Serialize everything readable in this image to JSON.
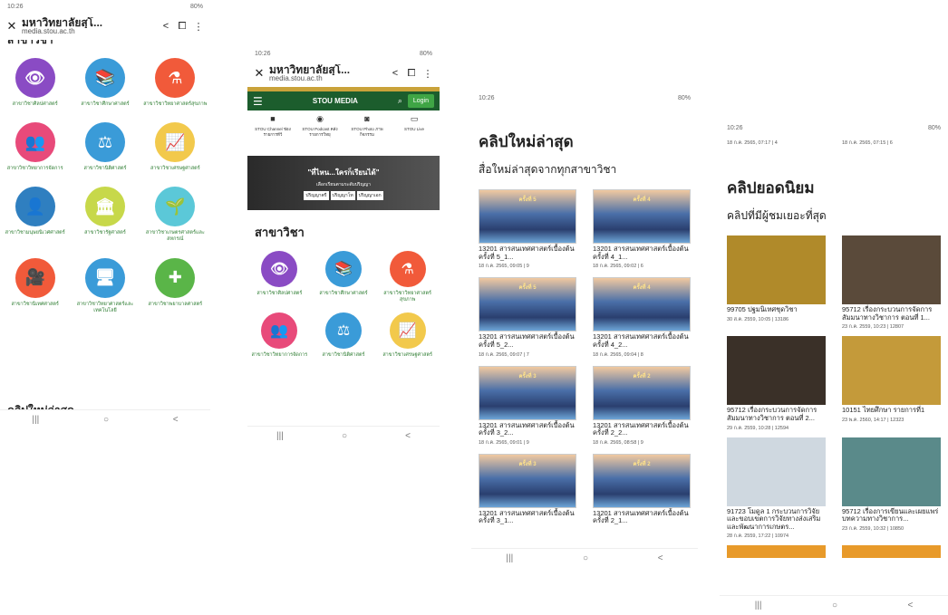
{
  "browser": {
    "title": "มหาวิทยาลัยสุโ...",
    "url": "media.stou.ac.th",
    "share": "<",
    "bookmark": "⧠",
    "more": "⋮",
    "close": "✕"
  },
  "status": {
    "time": "10:26",
    "battery": "80%"
  },
  "nav": {
    "recent": "|||",
    "home": "○",
    "back": "<"
  },
  "panel1": {
    "cut_top": "สาขาวิชา",
    "cut_bottom": "คลิปใหม่ล่าสุด",
    "items": [
      {
        "label": "สาขาวิชาศิลปศาสตร์",
        "color": "#8a4bc4",
        "glyph": "👁"
      },
      {
        "label": "สาขาวิชาศึกษาศาสตร์",
        "color": "#3a9bd8",
        "glyph": "📚"
      },
      {
        "label": "สาขาวิชาวิทยาศาสตร์สุขภาพ",
        "color": "#f15a3a",
        "glyph": "⚗"
      },
      {
        "label": "สาขาวิชาวิทยาการจัดการ",
        "color": "#e84a7a",
        "glyph": "👥"
      },
      {
        "label": "สาขาวิชานิติศาสตร์",
        "color": "#3a9bd8",
        "glyph": "⚖"
      },
      {
        "label": "สาขาวิชาเศรษฐศาสตร์",
        "color": "#f2c94c",
        "glyph": "📈"
      },
      {
        "label": "สาขาวิชามนุษยนิเวศศาสตร์",
        "color": "#2f7fc0",
        "glyph": "👤"
      },
      {
        "label": "สาขาวิชารัฐศาสตร์",
        "color": "#c7d84a",
        "glyph": "🏛"
      },
      {
        "label": "สาขาวิชาเกษตรศาสตร์และสหกรณ์",
        "color": "#5bc8d8",
        "glyph": "🌱"
      },
      {
        "label": "สาขาวิชานิเทศศาสตร์",
        "color": "#f15a3a",
        "glyph": "🎥"
      },
      {
        "label": "สาขาวิชาวิทยาศาสตร์และเทคโนโลยี",
        "color": "#3a9bd8",
        "glyph": "🖥"
      },
      {
        "label": "สาขาวิชาพยาบาลศาสตร์",
        "color": "#5ab548",
        "glyph": "✚"
      }
    ]
  },
  "panel2": {
    "brand": "STOU MEDIA",
    "login": "Login",
    "media": [
      {
        "glyph": "■",
        "text": "STOU Channel ช่องรายการทีวี"
      },
      {
        "glyph": "◉",
        "text": "STOU Podcast คลังรายการวิทยุ"
      },
      {
        "glyph": "◙",
        "text": "STOU Photo ภาพกิจกรรม"
      },
      {
        "glyph": "▭",
        "text": "STOU Live"
      }
    ],
    "banner": {
      "title": "\"ที่ไหน...ใครก็เรียนได้\"",
      "sub": "เลือกเรียนตามระดับปริญญา",
      "chips": [
        "ปริญญาตรี",
        "ปริญญาโท",
        "ปริญญาเอก"
      ]
    },
    "section": "สาขาวิชา",
    "items": [
      {
        "label": "สาขาวิชาศิลปศาสตร์",
        "color": "#8a4bc4",
        "glyph": "👁"
      },
      {
        "label": "สาขาวิชาศึกษาศาสตร์",
        "color": "#3a9bd8",
        "glyph": "📚"
      },
      {
        "label": "สาขาวิชาวิทยาศาสตร์สุขภาพ",
        "color": "#f15a3a",
        "glyph": "⚗"
      },
      {
        "label": "สาขาวิชาวิทยาการจัดการ",
        "color": "#e84a7a",
        "glyph": "👥"
      },
      {
        "label": "สาขาวิชานิติศาสตร์",
        "color": "#3a9bd8",
        "glyph": "⚖"
      },
      {
        "label": "สาขาวิชาเศรษฐศาสตร์",
        "color": "#f2c94c",
        "glyph": "📈"
      }
    ]
  },
  "panel3": {
    "title": "คลิปใหม่ล่าสุด",
    "subtitle": "สื่อใหม่ล่าสุดจากทุกสาขาวิชา",
    "videos": [
      {
        "thumb": "ครั้งที่ 5",
        "title": "13201 สารสนเทศศาสตร์เบื้องต้น ครั้งที่ 5_1...",
        "meta": "18 ก.ค. 2565, 09:05 | 9"
      },
      {
        "thumb": "ครั้งที่ 4",
        "title": "13201 สารสนเทศศาสตร์เบื้องต้น ครั้งที่ 4_1...",
        "meta": "18 ก.ค. 2565, 09:02 | 6"
      },
      {
        "thumb": "ครั้งที่ 5",
        "title": "13201 สารสนเทศศาสตร์เบื้องต้น ครั้งที่ 5_2...",
        "meta": "18 ก.ค. 2565, 09:07 | 7"
      },
      {
        "thumb": "ครั้งที่ 4",
        "title": "13201 สารสนเทศศาสตร์เบื้องต้น ครั้งที่ 4_2...",
        "meta": "18 ก.ค. 2565, 09:04 | 8"
      },
      {
        "thumb": "ครั้งที่ 3",
        "title": "13201 สารสนเทศศาสตร์เบื้องต้น ครั้งที่ 3_2...",
        "meta": "18 ก.ค. 2565, 09:01 | 9"
      },
      {
        "thumb": "ครั้งที่ 2",
        "title": "13201 สารสนเทศศาสตร์เบื้องต้น ครั้งที่ 2_2...",
        "meta": "18 ก.ค. 2565, 08:58 | 9"
      },
      {
        "thumb": "ครั้งที่ 3",
        "title": "13201 สารสนเทศศาสตร์เบื้องต้น ครั้งที่ 3_1...",
        "meta": ""
      },
      {
        "thumb": "ครั้งที่ 2",
        "title": "13201 สารสนเทศศาสตร์เบื้องต้น ครั้งที่ 2_1...",
        "meta": ""
      }
    ]
  },
  "panel4": {
    "top_meta": [
      "18 ก.ค. 2565, 07:17 | 4",
      "18 ก.ค. 2565, 07:15 | 6"
    ],
    "title": "คลิปยอดนิยม",
    "subtitle": "คลิปที่มีผู้ชมเยอะที่สุด",
    "videos": [
      {
        "bg": "#b08a2a",
        "title": "99705 ปฐมนิเทศชุดวิชา",
        "meta": "30 ส.ค. 2559, 10:05 | 13186"
      },
      {
        "bg": "#5a4a3a",
        "title": "95712 เรื่องกระบวนการจัดการสัมมนาทางวิชาการ ตอนที่ 1...",
        "meta": "23 ก.ค. 2559, 10:23 | 12807"
      },
      {
        "bg": "#3a3028",
        "title": "95712 เรื่องกระบวนการจัดการสัมมนาทางวิชาการ ตอนที่ 2...",
        "meta": "29 ก.ค. 2559, 10:28 | 12594"
      },
      {
        "bg": "#c49a3a",
        "title": "10151 ไทยศึกษา รายการที่1",
        "meta": "23 พ.ค. 2560, 14:17 | 12323"
      },
      {
        "bg": "#cfd8e0",
        "title": "91723 โมดูล 1 กระบวนการวิจัยและขอบเขตการวิจัยทางส่งเสริมและพัฒนาการเกษตร...",
        "meta": "28 ก.ค. 2559, 17:22 | 10974"
      },
      {
        "bg": "#5a8a8a",
        "title": "95712 เรื่องการเขียนและเผยแพร่บทความทางวิชาการ...",
        "meta": "23 ก.ค. 2559, 10:32 | 10850"
      },
      {
        "bg": "#e89a2a",
        "title": "",
        "meta": ""
      },
      {
        "bg": "#e89a2a",
        "title": "",
        "meta": ""
      }
    ]
  }
}
